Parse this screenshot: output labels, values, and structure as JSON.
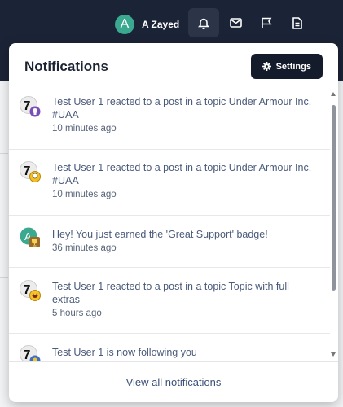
{
  "header": {
    "user_initial": "A",
    "user_name": "A Zayed",
    "icons": [
      "bell-icon",
      "mail-icon",
      "flag-icon",
      "document-icon"
    ]
  },
  "panel": {
    "title": "Notifications",
    "settings_label": "Settings",
    "view_all_label": "View all notifications"
  },
  "notifications": [
    {
      "text": "Test User 1 reacted to a post in a topic Under Armour Inc. #UAA",
      "time": "10 minutes ago",
      "badge": "trophy-badge"
    },
    {
      "text": "Test User 1 reacted to a post in a topic Under Armour Inc. #UAA",
      "time": "10 minutes ago",
      "badge": "thinking-badge"
    },
    {
      "text": "Hey! You just earned the 'Great Support' badge!",
      "time": "36 minutes ago",
      "badge": "award-badge"
    },
    {
      "text": "Test User 1 reacted to a post in a topic Topic with full extras",
      "time": "5 hours ago",
      "badge": "laughing-badge"
    },
    {
      "text": "Test User 1 is now following you",
      "time": "",
      "badge": "follow-badge"
    }
  ],
  "colors": {
    "topbar": "#1b2336",
    "accent": "#3aa98f",
    "button": "#141b2b",
    "link": "#3b4f78"
  }
}
